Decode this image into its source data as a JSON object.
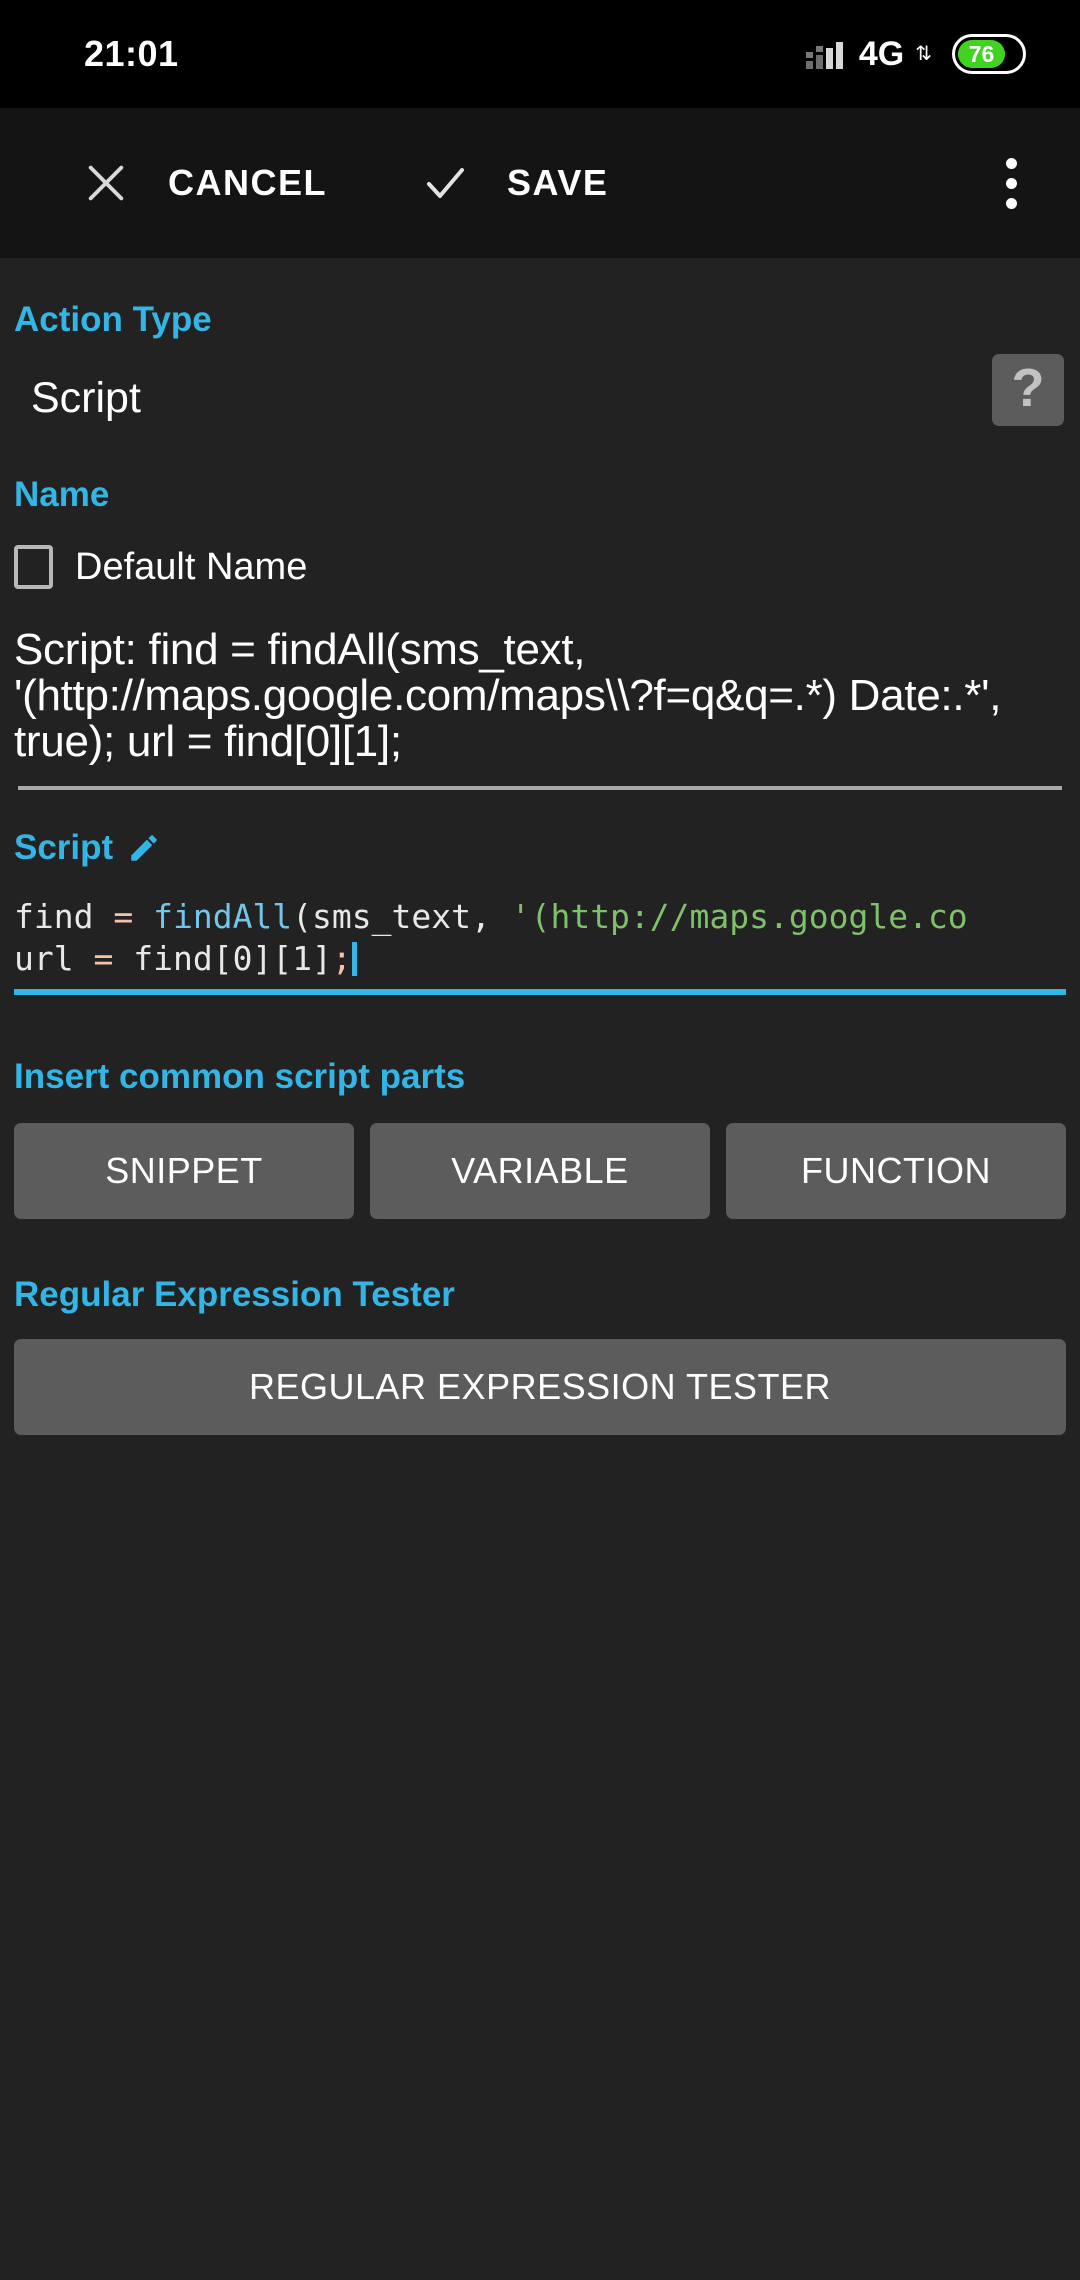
{
  "status_bar": {
    "time": "21:01",
    "network_label": "4G",
    "network_arrows": "⇅",
    "battery_level": "76",
    "battery_percent": 76,
    "signal_icon": "signal-bars-icon",
    "colors": {
      "battery_fill": "#41d321",
      "status_background": "#000000"
    }
  },
  "toolbar": {
    "cancel_label": "CANCEL",
    "cancel_icon": "close-x-icon",
    "save_label": "SAVE",
    "save_icon": "check-icon",
    "overflow_icon": "more-vertical-icon"
  },
  "action_type": {
    "label": "Action Type",
    "value": "Script",
    "help_icon": "question-mark-icon",
    "help_glyph": "?"
  },
  "name": {
    "label": "Name",
    "default_name_label": "Default Name",
    "default_name_checked": false,
    "value": "Script: find = findAll(sms_text, '(http://maps.google.com/maps\\\\?f=q&q=.*) Date:.*', true); url = find[0][1];"
  },
  "script": {
    "label": "Script",
    "edit_icon": "pencil-edit-icon",
    "line1": {
      "part1": "find ",
      "op1": "=",
      "part2": " ",
      "fn": "findAll",
      "part3": "(sms_text, ",
      "str": "'(http://maps.google.co"
    },
    "line2": {
      "part1": "url ",
      "op1": "=",
      "part2": " find[0][1]",
      "op2": ";"
    },
    "full_text": "find = findAll(sms_text, '(http://maps.google.com/maps\\\\?f=q&q=.*) Date:.*', true);\nurl = find[0][1];",
    "cursor_visible": true
  },
  "insert_parts": {
    "label": "Insert common script parts",
    "buttons": [
      {
        "label": "SNIPPET"
      },
      {
        "label": "VARIABLE"
      },
      {
        "label": "FUNCTION"
      }
    ]
  },
  "regex": {
    "label": "Regular Expression Tester",
    "button_label": "REGULAR EXPRESSION TESTER"
  },
  "theme": {
    "background": "#222222",
    "toolbar_background": "#141414",
    "accent": "#33b5e5",
    "button_gray": "#5c5c5c",
    "string_green": "#7fc06a",
    "function_blue": "#74c5e8",
    "operator_salmon": "#f5c3a8"
  }
}
